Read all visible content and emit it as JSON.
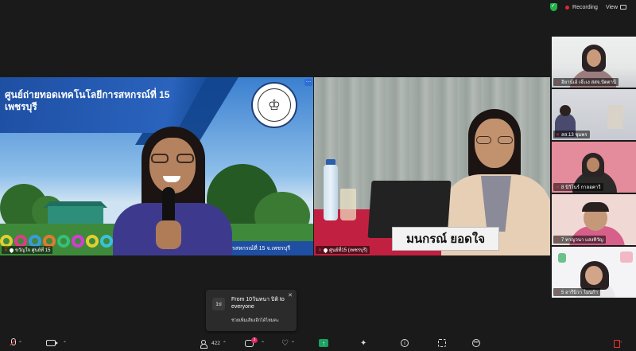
{
  "topbar": {
    "recording_label": "Recording",
    "view_label": "View"
  },
  "main_tiles": [
    {
      "banner_line1": "ศูนย์ถ่ายทอดเทคโนโลยีการสหกรณ์ที่ 15",
      "banner_line2": "เพชรบุรี",
      "bottom_strip": "ารสหกรณ์ที่ 15 จ.เพชรบุรี",
      "name": "ขวัญใจ ศูนย์ที่ 15"
    },
    {
      "nameplate": "มนกรณ์ ยอดใจ",
      "name": "ศูนย์ที่15 (เพชรบุรี)"
    }
  ],
  "gallery": [
    {
      "name": "ฮิยาน์เอ้ เจ๊ะเง สสจ.ปัตตานี"
    },
    {
      "name": "สส.13 ชุมพร"
    },
    {
      "name": "8 นิวิไนร์ กาลอคาวี"
    },
    {
      "name": "7 ทาญวนา แสงทิวัญ"
    },
    {
      "name": "5 อารีนิวา โมนก้า"
    }
  ],
  "chat_popup": {
    "avatar": "1ป",
    "title": "From 10วันทนา ปิติ to everyone",
    "message": "ช่วยเพิ่มเสียงอีกได้ไหมคะ"
  },
  "toolbar": {
    "participants_count": "422",
    "chat_badge": "3"
  },
  "colors": {
    "recording": "#e02828",
    "encryption": "#22b14c",
    "share": "#1aa260",
    "badge": "#e0245e"
  }
}
